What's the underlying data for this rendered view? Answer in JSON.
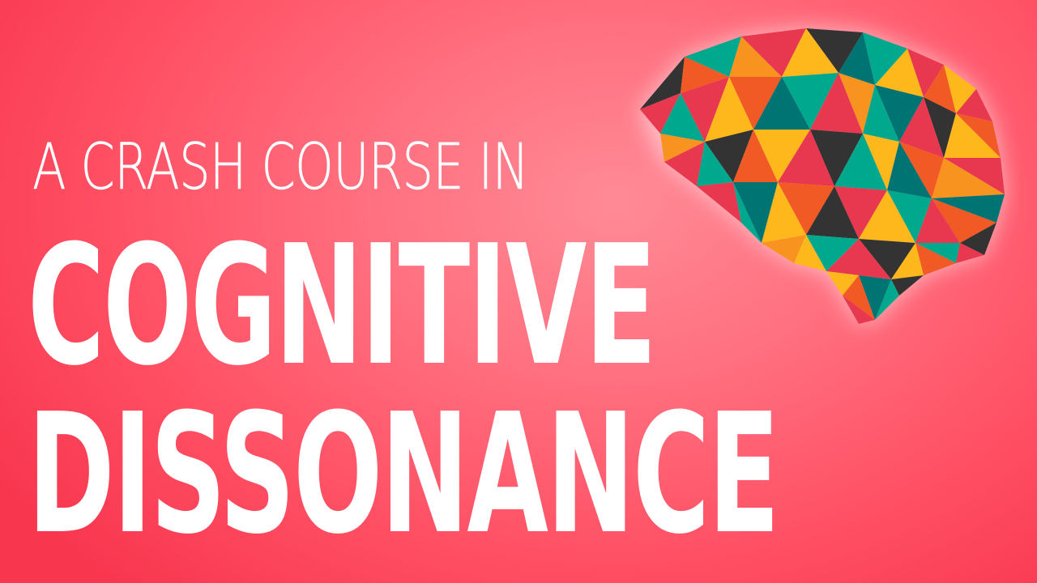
{
  "thumbnail": {
    "subtitle": "A CRASH COURSE IN",
    "title_line_1": "COGNITIVE",
    "title_line_2": "DISSONANCE"
  },
  "colors": {
    "background": "#ff5f70",
    "text": "#ffffff",
    "brain_palette": [
      "#f15a24",
      "#e8384f",
      "#00a88e",
      "#ffb81c",
      "#333333",
      "#007373",
      "#f7931e"
    ]
  },
  "icons": {
    "illustration": "low-poly-brain-icon"
  }
}
